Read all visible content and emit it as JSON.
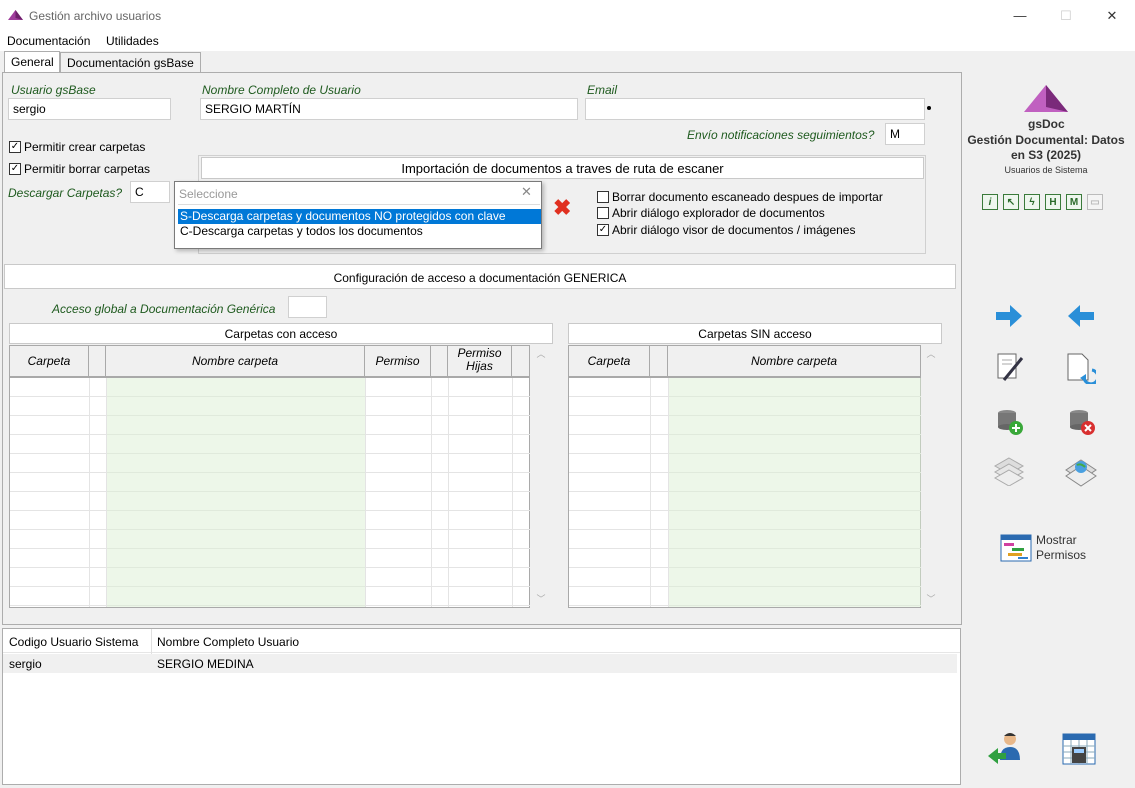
{
  "window": {
    "title": "Gestión archivo usuarios",
    "minimize": "—",
    "maximize": "☐",
    "close": "✕"
  },
  "menu": [
    "Documentación",
    "Utilidades"
  ],
  "tabs": [
    {
      "label": "General",
      "active": true
    },
    {
      "label": "Documentación gsBase",
      "active": false
    }
  ],
  "form": {
    "usuario_label": "Usuario gsBase",
    "usuario_value": "sergio",
    "nombre_label": "Nombre Completo de Usuario",
    "nombre_value": "SERGIO MARTÍN",
    "email_label": "Email",
    "email_value": "",
    "envio_label": "Envío notificaciones seguimientos?",
    "envio_value": "M",
    "permitir_crear": {
      "label": "Permitir crear carpetas",
      "checked": true
    },
    "permitir_borrar": {
      "label": "Permitir borrar carpetas",
      "checked": true
    },
    "descargar_label": "Descargar Carpetas?",
    "descargar_value": "C"
  },
  "importacion": {
    "header": "Importación de documentos a traves de ruta de escaner",
    "borrar": {
      "label": "Borrar documento escaneado despues de importar",
      "checked": false
    },
    "abrir_explorador": {
      "label": "Abrir diálogo explorador de documentos",
      "checked": false
    },
    "abrir_visor": {
      "label": "Abrir diálogo visor de documentos / imágenes",
      "checked": true
    }
  },
  "dropdown": {
    "placeholder": "Seleccione",
    "options": [
      {
        "label": "S-Descarga carpetas y documentos NO protegidos con clave",
        "selected": true
      },
      {
        "label": "C-Descarga carpetas y todos los documentos",
        "selected": false
      }
    ]
  },
  "config": {
    "header": "Configuración de acceso a documentación GENERICA",
    "acceso_label": "Acceso global a Documentación Genérica",
    "acceso_value": ""
  },
  "carpetas_acceso": {
    "title": "Carpetas con acceso",
    "columns": [
      "Carpeta",
      "",
      "Nombre carpeta",
      "Permiso",
      "",
      "Permiso Hijas"
    ]
  },
  "carpetas_sin_acceso": {
    "title": "Carpetas SIN acceso",
    "columns": [
      "Carpeta",
      "",
      "Nombre carpeta"
    ]
  },
  "usuarios_table": {
    "columns": [
      "Codigo Usuario Sistema",
      "Nombre Completo Usuario"
    ],
    "rows": [
      [
        "sergio",
        "SERGIO MEDINA"
      ]
    ]
  },
  "side": {
    "app_name": "gsDoc",
    "app_title": "Gestión Documental: Datos en S3 (2025)",
    "app_subtitle": "Usuarios de Sistema",
    "tool_icons": [
      "info-icon",
      "pointer-icon",
      "lightning-icon",
      "h-icon",
      "m-icon",
      "comment-icon"
    ],
    "mostrar_permisos": "Mostrar\nPermisos"
  },
  "colors": {
    "label_green": "#1e5a1e",
    "selection_blue": "#0078d7",
    "grid_row_green": "#eef7ea",
    "brand_purple": "#a03c9c"
  }
}
